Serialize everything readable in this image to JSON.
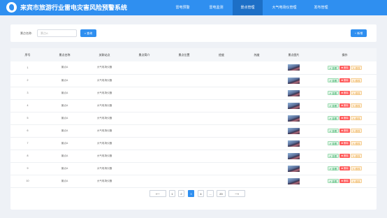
{
  "header": {
    "title": "来宾市旅游行业雷电灾害风险预警系统",
    "nav": [
      {
        "label": "雷电预警"
      },
      {
        "label": "雷电监测"
      },
      {
        "label": "景点管理"
      },
      {
        "label": "大气电场仪管理"
      },
      {
        "label": "发布管理"
      }
    ],
    "active_tab": 2
  },
  "search": {
    "label": "景点名称:",
    "placeholder": "景点A",
    "search_button": "查询",
    "add_button": "+ 新增"
  },
  "table": {
    "columns": [
      "序号",
      "景点名称",
      "关联站点",
      "景点简介",
      "景点位置",
      "经度",
      "纬度",
      "景点图片",
      "操作"
    ],
    "rows": [
      {
        "index": "1",
        "name": "景点A",
        "station": "大气电场仪器"
      },
      {
        "index": "2",
        "name": "景点A",
        "station": "大气电场仪器"
      },
      {
        "index": "3",
        "name": "景点A",
        "station": "大气电场仪器"
      },
      {
        "index": "4",
        "name": "景点A",
        "station": "大气电场仪器"
      },
      {
        "index": "5",
        "name": "景点A",
        "station": "大气电场仪器"
      },
      {
        "index": "6",
        "name": "景点A",
        "station": "大气电场仪器"
      },
      {
        "index": "7",
        "name": "景点A",
        "station": "大气电场仪器"
      },
      {
        "index": "8",
        "name": "景点A",
        "station": "大气电场仪器"
      },
      {
        "index": "9",
        "name": "景点A",
        "station": "大气电场仪器"
      },
      {
        "index": "10",
        "name": "景点A",
        "station": "大气电场仪器"
      }
    ],
    "actions": {
      "view": "✔ 查看",
      "delete": "✖ 删除",
      "edit": "✎ 修改"
    }
  },
  "pagination": {
    "prev": "⟵",
    "pages": [
      "1",
      "2",
      "3",
      "4",
      "...",
      "20"
    ],
    "current": "3",
    "next": "⟶"
  },
  "colors": {
    "primary": "#2f8ff0",
    "danger": "#ff5a5a",
    "success": "#2aa55a",
    "warning": "#e6a23c"
  }
}
